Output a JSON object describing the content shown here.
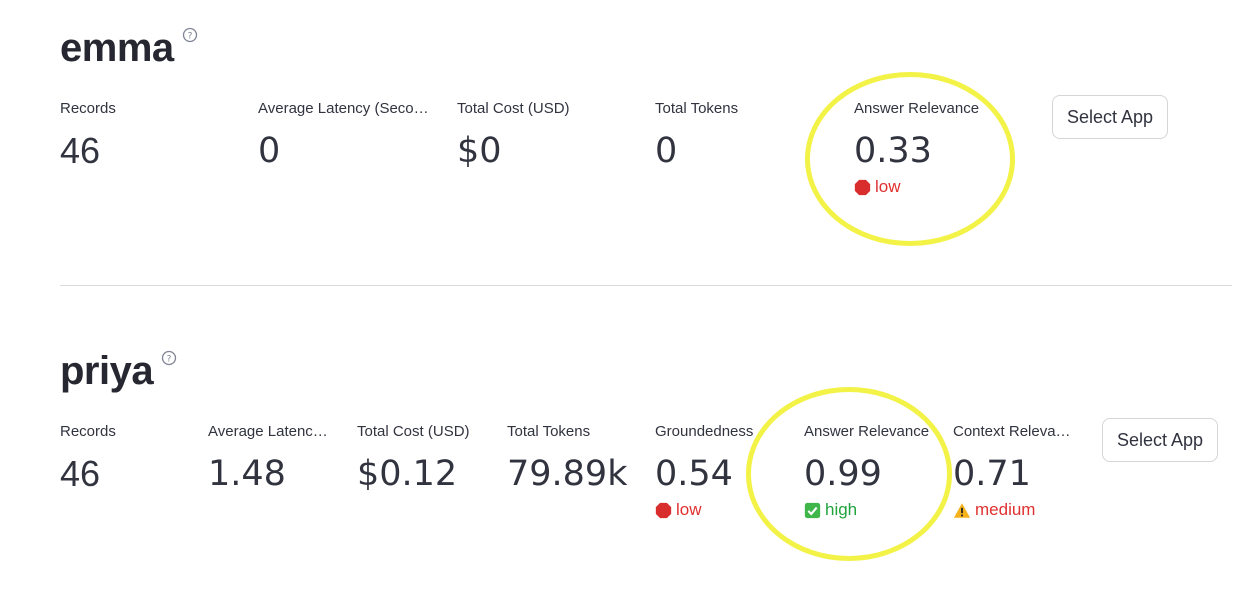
{
  "apps": [
    {
      "name": "emma",
      "metrics": [
        {
          "label": "Records",
          "value": "46"
        },
        {
          "label": "Average Latency (Seco…",
          "value": "0"
        },
        {
          "label": "Total Cost (USD)",
          "value": "$0"
        },
        {
          "label": "Total Tokens",
          "value": "0"
        },
        {
          "label": "Answer Relevance",
          "value": "0.33",
          "delta": "low",
          "delta_icon": "stop-sign-icon"
        }
      ],
      "button_label": "Select App"
    },
    {
      "name": "priya",
      "metrics": [
        {
          "label": "Records",
          "value": "46"
        },
        {
          "label": "Average Latenc…",
          "value": "1.48"
        },
        {
          "label": "Total Cost (USD)",
          "value": "$0.12"
        },
        {
          "label": "Total Tokens",
          "value": "79.89k"
        },
        {
          "label": "Groundedness",
          "value": "0.54",
          "delta": "low",
          "delta_icon": "stop-sign-icon"
        },
        {
          "label": "Answer Relevance",
          "value": "0.99",
          "delta": "high",
          "delta_icon": "check-box-icon"
        },
        {
          "label": "Context Releva…",
          "value": "0.71",
          "delta": "medium",
          "delta_icon": "warning-icon"
        }
      ],
      "button_label": "Select App"
    }
  ],
  "colors": {
    "low": "#e03030",
    "high": "#21a33c",
    "medium": "#e03030",
    "highlight": "#f2f247"
  }
}
